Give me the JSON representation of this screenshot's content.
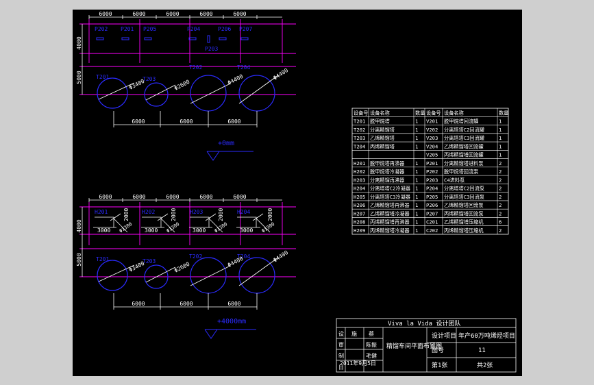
{
  "dims_top": [
    "6000",
    "6000",
    "6000",
    "6000",
    "6000"
  ],
  "dim_4000": "4000",
  "dim_5000": "5000",
  "pumps_upper": [
    "P202",
    "P201",
    "P205",
    "P204",
    "P206",
    "P207"
  ],
  "pump_p203": "P203",
  "tanks_upper": [
    {
      "label": "T201",
      "dia": "Φ3400"
    },
    {
      "label": "T203",
      "dia": "Φ2600"
    },
    {
      "label": "T202",
      "dia": "Φ4400"
    },
    {
      "label": "T204",
      "dia": "Φ4400"
    }
  ],
  "dims_bottom": [
    "6000",
    "6000",
    "6000"
  ],
  "level_upper": "+0mm",
  "hx_labels": [
    "H201",
    "H202",
    "H203",
    "H204",
    "H205",
    "H206",
    "H207",
    "H208",
    "H209"
  ],
  "hx_dims": [
    "2000",
    "2000",
    "3000",
    "3000",
    "3000",
    "2000",
    "3000",
    "2000"
  ],
  "hx_dia": [
    "Φ1300",
    "Φ1300",
    "Φ1300",
    "Φ1300",
    "Φ1300",
    "Φ1300",
    "Φ1300",
    "Φ1300"
  ],
  "tanks_lower": [
    {
      "label": "T201",
      "dia": "Φ3400"
    },
    {
      "label": "T203",
      "dia": "Φ2600"
    },
    {
      "label": "T202",
      "dia": "Φ4400"
    },
    {
      "label": "T204",
      "dia": "Φ4400"
    }
  ],
  "level_lower": "+4000mm",
  "equip_table": {
    "headers": [
      "设备号",
      "设备名称",
      "数量",
      "设备号",
      "设备名称",
      "数量"
    ],
    "rows": [
      [
        "T201",
        "脱甲烷塔",
        "1",
        "V201",
        "脱甲烷塔回流罐",
        "1"
      ],
      [
        "T202",
        "分离精馏塔",
        "1",
        "V202",
        "分离塔塔C2回流罐",
        "1"
      ],
      [
        "T203",
        "乙烯精馏塔",
        "1",
        "V203",
        "分离塔塔C3回流罐",
        "1"
      ],
      [
        "T204",
        "丙烯精馏塔",
        "1",
        "V204",
        "乙烯精馏塔回流罐",
        "1"
      ],
      [
        "",
        "",
        "",
        "V205",
        "丙烯精馏塔回流罐",
        "1"
      ],
      [
        "H201",
        "脱甲烷塔再沸器",
        "1",
        "P201",
        "分离精馏塔进料泵",
        "2"
      ],
      [
        "H202",
        "脱甲烷塔冷凝器",
        "1",
        "P202",
        "脱甲烷塔回流泵",
        "2"
      ],
      [
        "H203",
        "分离精馏再沸器",
        "1",
        "P203",
        "C4进料泵",
        "2"
      ],
      [
        "H204",
        "分离塔塔C2冷凝器",
        "1",
        "P204",
        "分离塔塔C2回流泵",
        "2"
      ],
      [
        "H205",
        "分离塔塔C3冷凝器",
        "1",
        "P205",
        "分离塔塔C3回流泵",
        "2"
      ],
      [
        "H206",
        "乙烯精馏塔再沸器",
        "1",
        "P206",
        "乙烯精馏塔回流泵",
        "2"
      ],
      [
        "H207",
        "乙烯精馏塔冷凝器",
        "1",
        "P207",
        "丙烯精馏塔回流泵",
        "2"
      ],
      [
        "H208",
        "丙烯精馏塔再沸器",
        "1",
        "C201",
        "乙烯精馏塔压缩机",
        "6"
      ],
      [
        "H209",
        "丙烯精馏塔冷凝器",
        "1",
        "C202",
        "丙烯精馏塔压缩机",
        "2"
      ]
    ]
  },
  "title_block": {
    "team": "Viva la Vida 设计团队",
    "left_cells": [
      "设",
      "计",
      "审",
      "核",
      "制",
      "图",
      "日",
      "期"
    ],
    "names": [
      "施",
      "蔡",
      "毛健",
      "陈振"
    ],
    "date": "2011年9月5日",
    "drawing_name": "精馏车间平面布置图",
    "project_label": "设计项目",
    "project_value": "年产60万吨烯烃项目",
    "scale_label": "图号",
    "page_no": "11",
    "sheet_label": "第1张",
    "total_label": "共2张"
  },
  "colors": {
    "line": "#ff00ff",
    "accent": "#0000ff",
    "text": "#ffffff",
    "tank": "#2b2bff",
    "bg": "#000000"
  }
}
